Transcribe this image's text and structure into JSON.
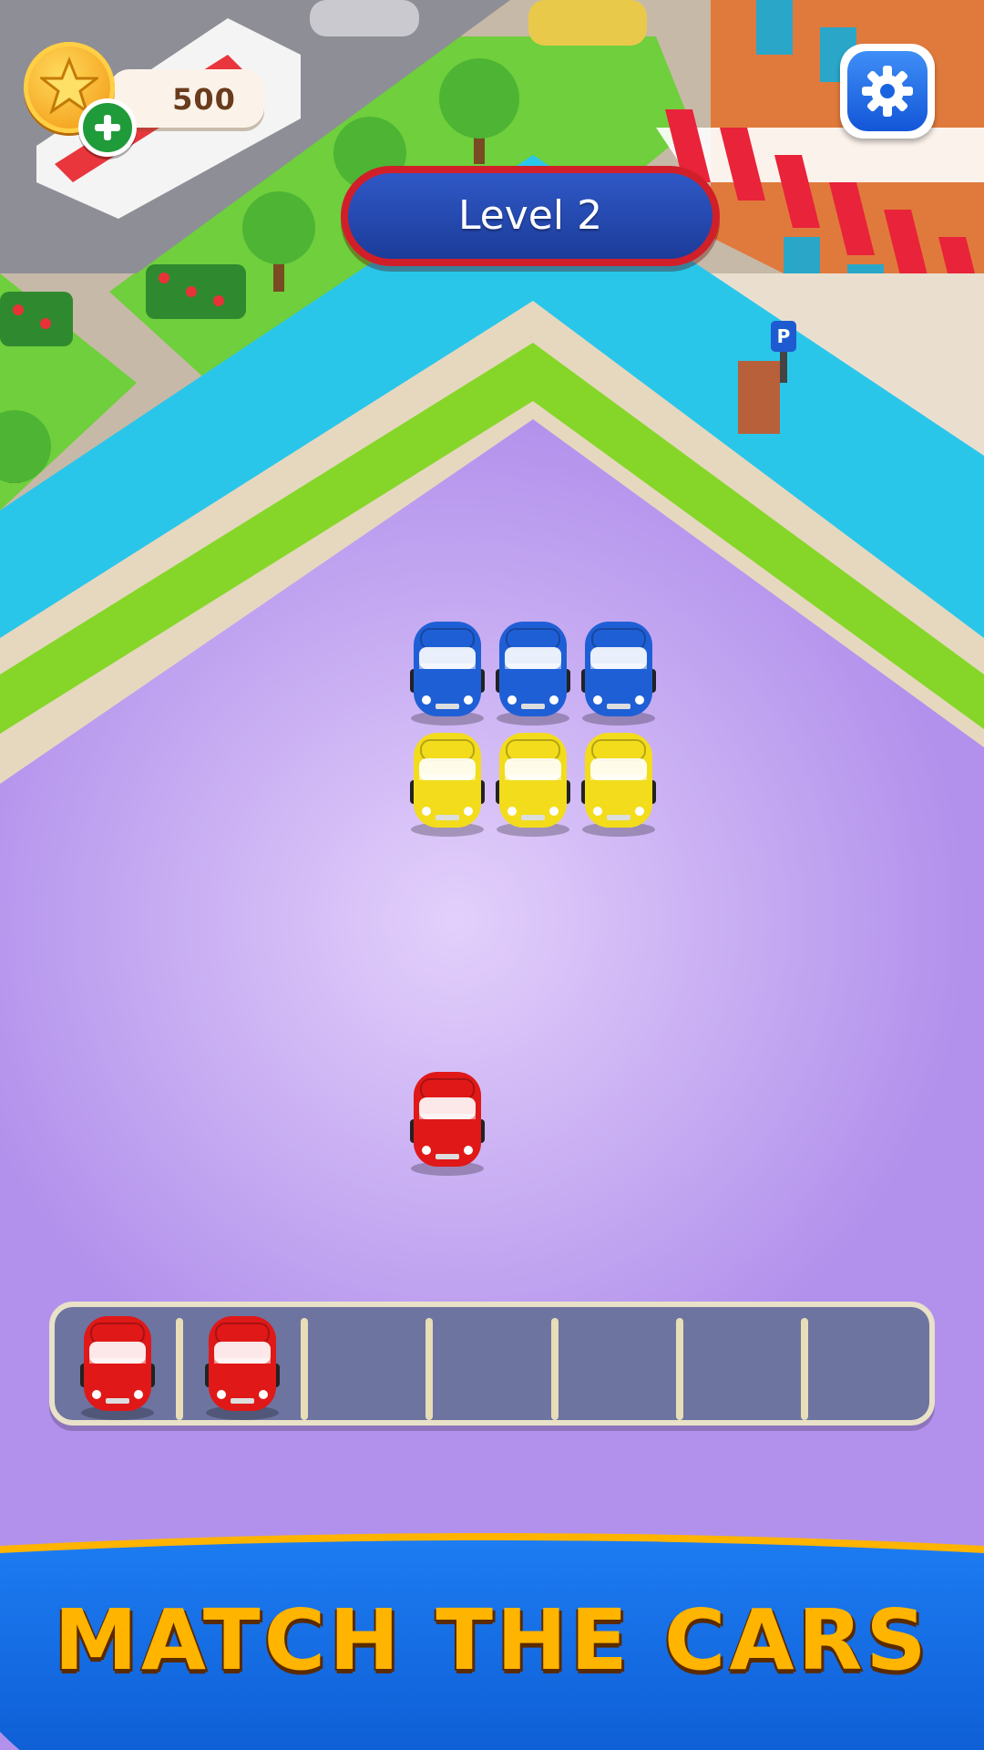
{
  "hud": {
    "coins": "500",
    "level_label": "Level 2"
  },
  "board": {
    "rows": [
      [
        "blue",
        "blue",
        "blue"
      ],
      [
        "yellow",
        "yellow",
        "yellow"
      ]
    ],
    "active_car": "red"
  },
  "tray": {
    "slot_count": 7,
    "filled": [
      "red",
      "red"
    ]
  },
  "banner": {
    "text": "MATCH THE CARS"
  },
  "colors": {
    "red": "#e01818",
    "blue": "#1f5fd6",
    "yellow": "#f2dc1c",
    "board": "#b291ec",
    "water": "#29c6ea",
    "grass": "#86d629",
    "banner_blue": "#1670ec",
    "title_gold": "#ffb400"
  },
  "icons": {
    "coin": "star-icon",
    "add": "plus-icon",
    "settings": "gear-icon",
    "parking": "parking-sign-icon"
  }
}
